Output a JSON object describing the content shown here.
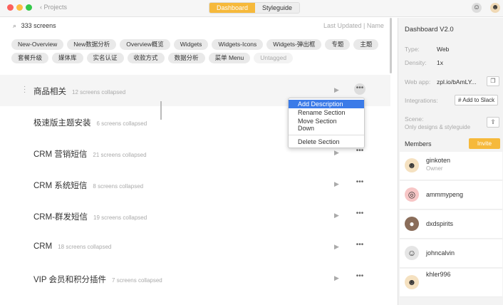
{
  "header": {
    "back_label": "Projects",
    "tabs": [
      "Dashboard",
      "Styleguide"
    ],
    "active_tab": "Dashboard"
  },
  "toolbar": {
    "search_value": "333 screens",
    "sort_label": "Last Updated | Name"
  },
  "tags": [
    "New-Overview",
    "New数据分析",
    "Overview概览",
    "Widgets",
    "Widgets-Icons",
    "Widgets-弹出框",
    "专题",
    "主题",
    "套餐升级",
    "媒体库",
    "实名认证",
    "收款方式",
    "数据分析",
    "菜单 Menu",
    "Untagged"
  ],
  "sections": [
    {
      "name": "商品相关",
      "count": "12 screens collapsed"
    },
    {
      "name": "极速版主题安装",
      "count": "6 screens collapsed"
    },
    {
      "name": "CRM 营销短信",
      "count": "21 screens collapsed"
    },
    {
      "name": "CRM 系统短信",
      "count": "8 screens collapsed"
    },
    {
      "name": "CRM-群发短信",
      "count": "19 screens collapsed"
    },
    {
      "name": "CRM",
      "count": "18 screens collapsed"
    },
    {
      "name": "VIP 会员和积分插件",
      "count": "7 screens collapsed"
    }
  ],
  "context_menu": {
    "items": [
      "Add Description",
      "Rename Section",
      "Move Section Down",
      "Delete Section"
    ],
    "selected": "Add Description"
  },
  "sidebar": {
    "title": "Dashboard V2.0",
    "type_label": "Type:",
    "type_value": "Web",
    "density_label": "Density:",
    "density_value": "1x",
    "webapp_label": "Web app:",
    "webapp_value": "zpl.io/bAmLY...",
    "integrations_label": "Integrations:",
    "slack_label": "Add to Slack",
    "scene_label": "Scene:",
    "scene_value": "Only designs & styleguide",
    "members_label": "Members",
    "invite_label": "Invite",
    "members": [
      {
        "name": "ginkoten",
        "role": "Owner"
      },
      {
        "name": "ammmypeng",
        "role": ""
      },
      {
        "name": "dxdspirits",
        "role": ""
      },
      {
        "name": "johncalvin",
        "role": ""
      },
      {
        "name": "khler996",
        "role": ""
      }
    ]
  },
  "colors": {
    "accent": "#f6b93b",
    "menu_highlight": "#3b7be8"
  }
}
